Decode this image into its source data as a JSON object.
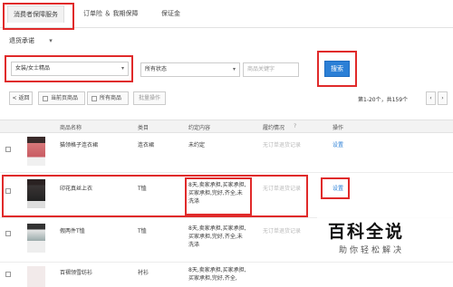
{
  "tabs": [
    {
      "label": "消费者保障服务"
    },
    {
      "label": "订单险 ＆ 我期保障"
    },
    {
      "label": "保证金"
    }
  ],
  "section": {
    "title": "退货承诺",
    "caret": "▾"
  },
  "filters": {
    "category": "女装/女士精品",
    "status": "所有状态",
    "keyword_placeholder": "商品关键字",
    "search_label": "搜索",
    "caret": "▾"
  },
  "toolbar": {
    "prev_label": "< 返回",
    "current_page_label": "当前页商品",
    "all_label": "所有商品",
    "bulk_label": "批量操作",
    "pagination": "第1-20个，共159个",
    "prev_icon": "‹",
    "next_icon": "›"
  },
  "table": {
    "headers": [
      "商品名称",
      "类目",
      "约定内容",
      "履约情况",
      "操作"
    ],
    "header_help": "?",
    "rows": [
      {
        "name": "猫领格子连衣裙",
        "category": "连衣裙",
        "promise": "未约定",
        "record": "无订单退货记录",
        "action": "设置"
      },
      {
        "name": "印花真丝上衣",
        "category": "T恤",
        "promise": "8天,卖家承担,买家承担,买家承担,完好,齐全,未洗涤",
        "record": "无订单退货记录",
        "action": "设置"
      },
      {
        "name": "假两件T恤",
        "category": "T恤",
        "promise": "8天,卖家承担,买家承担,买家承担,完好,齐全,未洗涤",
        "record": "无订单退货记录",
        "action": "设置"
      },
      {
        "name": "百褶领雪纺衫",
        "category": "衬衫",
        "promise": "8天,卖家承担,买家承担,买家承担,完好,齐全,",
        "record": "",
        "action": ""
      }
    ]
  },
  "watermark": {
    "title": "百科全说",
    "subtitle": "助你轻松解决"
  },
  "colors": {
    "accent": "#2b7fd6",
    "highlight_red": "#e02a2a"
  }
}
